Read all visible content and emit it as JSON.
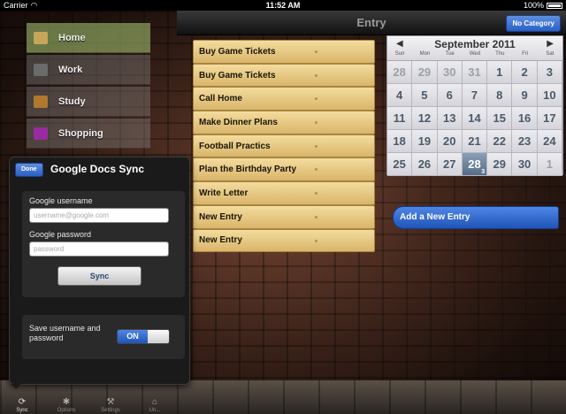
{
  "status_bar": {
    "carrier": "Carrier",
    "time": "11:52 AM",
    "battery": "100%"
  },
  "nav": {
    "title": "Entry",
    "category_button": "No Category"
  },
  "sidebar": {
    "items": [
      {
        "label": "Home",
        "icon": "home-icon",
        "color": "#c7a65a"
      },
      {
        "label": "Work",
        "icon": "briefcase-icon",
        "color": "#6b6b6b"
      },
      {
        "label": "Study",
        "icon": "book-icon",
        "color": "#b0782c"
      },
      {
        "label": "Shopping",
        "icon": "shopping-icon",
        "color": "#9a2aa2"
      }
    ]
  },
  "tasks": [
    "Buy Game Tickets",
    "Buy Game Tickets",
    "Call Home",
    "Make Dinner Plans",
    "Football Practics",
    "Plan the Birthday Party",
    "Write Letter",
    "New Entry",
    "New Entry"
  ],
  "calendar": {
    "title": "September 2011",
    "prev": "◀",
    "next": "▶",
    "dows": [
      "Sun",
      "Mon",
      "Tue",
      "Wed",
      "Thu",
      "Fri",
      "Sat"
    ],
    "weeks": [
      [
        "28",
        "29",
        "30",
        "31",
        "1",
        "2",
        "3"
      ],
      [
        "4",
        "5",
        "6",
        "7",
        "8",
        "9",
        "10"
      ],
      [
        "11",
        "12",
        "13",
        "14",
        "15",
        "16",
        "17"
      ],
      [
        "18",
        "19",
        "20",
        "21",
        "22",
        "23",
        "24"
      ],
      [
        "25",
        "26",
        "27",
        "28",
        "29",
        "30",
        "1"
      ]
    ],
    "today_badge": "3"
  },
  "add_entry": "Add a New Entry",
  "popover": {
    "done": "Done",
    "title": "Google Docs Sync",
    "username_label": "Google username",
    "username_placeholder": "username@google.com",
    "password_label": "Google password",
    "password_placeholder": "password",
    "sync": "Sync",
    "save_label": "Save username and password",
    "toggle": "ON"
  },
  "tabs": [
    {
      "label": "Sync",
      "icon": "sync-icon",
      "glyph": "⟳"
    },
    {
      "label": "Options",
      "icon": "gear-icon",
      "glyph": "✱"
    },
    {
      "label": "Settings",
      "icon": "wrench-icon",
      "glyph": "⚒"
    },
    {
      "label": "Un...",
      "icon": "trash-icon",
      "glyph": "⌂"
    }
  ]
}
